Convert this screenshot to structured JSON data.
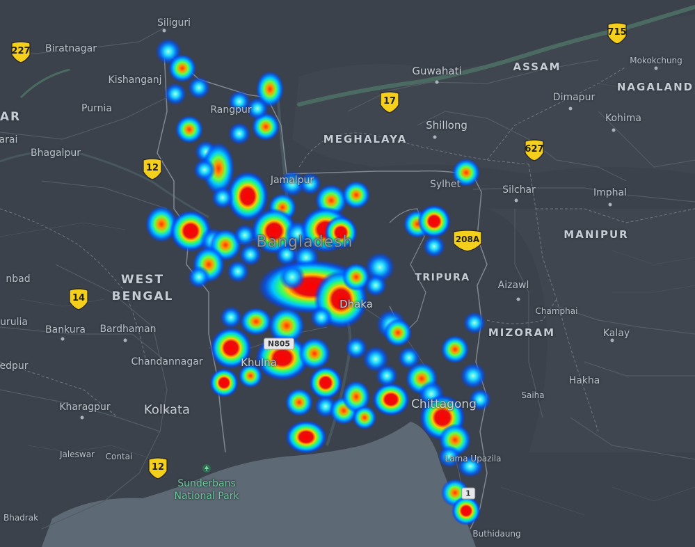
{
  "map": {
    "colors": {
      "land": "#3b424b",
      "water": "#5d6a75",
      "border": "#7f8892",
      "road": "#535b65",
      "river": "#4a6a62",
      "shield": "#f4cf1b"
    },
    "places": [
      {
        "id": "siliguri",
        "name": "Siliguri"
      },
      {
        "id": "biratnagar",
        "name": "Biratnagar"
      },
      {
        "id": "kishanganj",
        "name": "Kishanganj"
      },
      {
        "id": "purnia",
        "name": "Purnia"
      },
      {
        "id": "bhagalpur",
        "name": "Bhagalpur"
      },
      {
        "id": "arai",
        "name": "arai"
      },
      {
        "id": "bangpur",
        "name": "Rangpur"
      },
      {
        "id": "jamalpur",
        "name": "Jamalpur"
      },
      {
        "id": "guwahati",
        "name": "Guwahati"
      },
      {
        "id": "shillong",
        "name": "Shillong"
      },
      {
        "id": "sylhet",
        "name": "Sylhet"
      },
      {
        "id": "silchar",
        "name": "Silchar"
      },
      {
        "id": "imphal",
        "name": "Imphal"
      },
      {
        "id": "dimapur",
        "name": "Dimapur"
      },
      {
        "id": "kohima",
        "name": "Kohima"
      },
      {
        "id": "mokokchung",
        "name": "Mokokchung"
      },
      {
        "id": "aizawl",
        "name": "Aizawl"
      },
      {
        "id": "champhai",
        "name": "Champhai"
      },
      {
        "id": "kalay",
        "name": "Kalay"
      },
      {
        "id": "hakha",
        "name": "Hakha"
      },
      {
        "id": "saiha",
        "name": "Saiha"
      },
      {
        "id": "dhaka",
        "name": "Dhaka"
      },
      {
        "id": "khulna",
        "name": "Khulna"
      },
      {
        "id": "chittagong",
        "name": "Chittagong"
      },
      {
        "id": "lama",
        "name": "Lama Upazila"
      },
      {
        "id": "buthidaung",
        "name": "Buthidaung"
      },
      {
        "id": "bankura",
        "name": "Bankura"
      },
      {
        "id": "bardhaman",
        "name": "Bardhaman"
      },
      {
        "id": "chandannagar",
        "name": "Chandannagar"
      },
      {
        "id": "kolkata",
        "name": "Kolkata"
      },
      {
        "id": "kharagpur",
        "name": "Kharagpur"
      },
      {
        "id": "jaleswar",
        "name": "Jaleswar"
      },
      {
        "id": "contai",
        "name": "Contai"
      },
      {
        "id": "bhadrak",
        "name": "Bhadrak"
      },
      {
        "id": "nbad",
        "name": "nbad"
      },
      {
        "id": "urulia",
        "name": "urulia"
      },
      {
        "id": "edpur",
        "name": "edpur"
      }
    ],
    "regions": {
      "assam": "ASSAM",
      "nagaland": "NAGALAND",
      "meghalaya": "MEGHALAYA",
      "manipur": "MANIPUR",
      "tripura": "TRIPURA",
      "mizoram": "MIZORAM",
      "west": "WEST",
      "bengal": "BENGAL",
      "ar": "AR",
      "bangladesh": "Bangladesh"
    },
    "park": {
      "line1": "Sunderbans",
      "line2": "National Park"
    },
    "shields": [
      {
        "id": "s227",
        "label": "227"
      },
      {
        "id": "s12a",
        "label": "12"
      },
      {
        "id": "s17",
        "label": "17"
      },
      {
        "id": "s715",
        "label": "715"
      },
      {
        "id": "s627",
        "label": "627"
      },
      {
        "id": "s208a",
        "label": "208A"
      },
      {
        "id": "s14",
        "label": "14"
      },
      {
        "id": "s12b",
        "label": "12"
      }
    ],
    "road_badges": [
      {
        "id": "n805",
        "label": "N805"
      },
      {
        "id": "n1",
        "label": "1"
      }
    ]
  }
}
